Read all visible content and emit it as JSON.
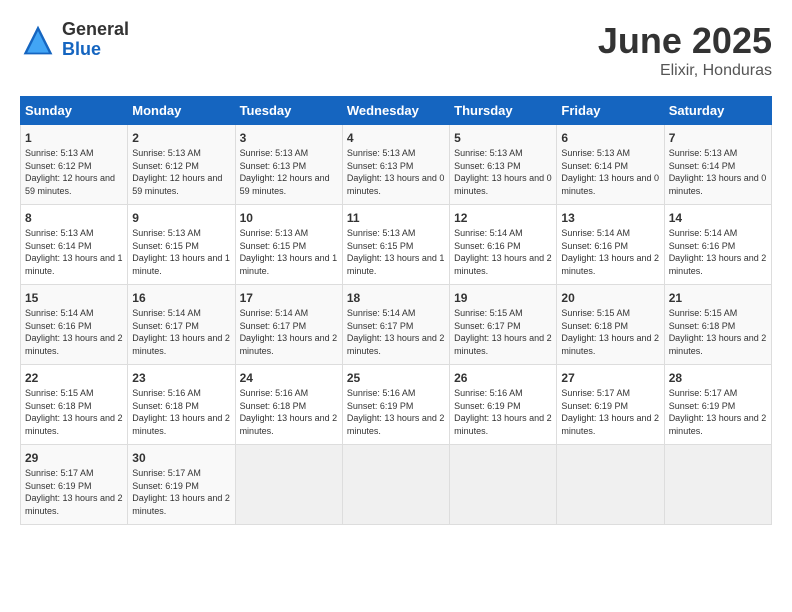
{
  "header": {
    "logo_general": "General",
    "logo_blue": "Blue",
    "title": "June 2025",
    "subtitle": "Elixir, Honduras"
  },
  "days_of_week": [
    "Sunday",
    "Monday",
    "Tuesday",
    "Wednesday",
    "Thursday",
    "Friday",
    "Saturday"
  ],
  "weeks": [
    [
      {
        "day": "1",
        "sunrise": "5:13 AM",
        "sunset": "6:12 PM",
        "daylight": "12 hours and 59 minutes."
      },
      {
        "day": "2",
        "sunrise": "5:13 AM",
        "sunset": "6:12 PM",
        "daylight": "12 hours and 59 minutes."
      },
      {
        "day": "3",
        "sunrise": "5:13 AM",
        "sunset": "6:13 PM",
        "daylight": "12 hours and 59 minutes."
      },
      {
        "day": "4",
        "sunrise": "5:13 AM",
        "sunset": "6:13 PM",
        "daylight": "13 hours and 0 minutes."
      },
      {
        "day": "5",
        "sunrise": "5:13 AM",
        "sunset": "6:13 PM",
        "daylight": "13 hours and 0 minutes."
      },
      {
        "day": "6",
        "sunrise": "5:13 AM",
        "sunset": "6:14 PM",
        "daylight": "13 hours and 0 minutes."
      },
      {
        "day": "7",
        "sunrise": "5:13 AM",
        "sunset": "6:14 PM",
        "daylight": "13 hours and 0 minutes."
      }
    ],
    [
      {
        "day": "8",
        "sunrise": "5:13 AM",
        "sunset": "6:14 PM",
        "daylight": "13 hours and 1 minute."
      },
      {
        "day": "9",
        "sunrise": "5:13 AM",
        "sunset": "6:15 PM",
        "daylight": "13 hours and 1 minute."
      },
      {
        "day": "10",
        "sunrise": "5:13 AM",
        "sunset": "6:15 PM",
        "daylight": "13 hours and 1 minute."
      },
      {
        "day": "11",
        "sunrise": "5:13 AM",
        "sunset": "6:15 PM",
        "daylight": "13 hours and 1 minute."
      },
      {
        "day": "12",
        "sunrise": "5:14 AM",
        "sunset": "6:16 PM",
        "daylight": "13 hours and 2 minutes."
      },
      {
        "day": "13",
        "sunrise": "5:14 AM",
        "sunset": "6:16 PM",
        "daylight": "13 hours and 2 minutes."
      },
      {
        "day": "14",
        "sunrise": "5:14 AM",
        "sunset": "6:16 PM",
        "daylight": "13 hours and 2 minutes."
      }
    ],
    [
      {
        "day": "15",
        "sunrise": "5:14 AM",
        "sunset": "6:16 PM",
        "daylight": "13 hours and 2 minutes."
      },
      {
        "day": "16",
        "sunrise": "5:14 AM",
        "sunset": "6:17 PM",
        "daylight": "13 hours and 2 minutes."
      },
      {
        "day": "17",
        "sunrise": "5:14 AM",
        "sunset": "6:17 PM",
        "daylight": "13 hours and 2 minutes."
      },
      {
        "day": "18",
        "sunrise": "5:14 AM",
        "sunset": "6:17 PM",
        "daylight": "13 hours and 2 minutes."
      },
      {
        "day": "19",
        "sunrise": "5:15 AM",
        "sunset": "6:17 PM",
        "daylight": "13 hours and 2 minutes."
      },
      {
        "day": "20",
        "sunrise": "5:15 AM",
        "sunset": "6:18 PM",
        "daylight": "13 hours and 2 minutes."
      },
      {
        "day": "21",
        "sunrise": "5:15 AM",
        "sunset": "6:18 PM",
        "daylight": "13 hours and 2 minutes."
      }
    ],
    [
      {
        "day": "22",
        "sunrise": "5:15 AM",
        "sunset": "6:18 PM",
        "daylight": "13 hours and 2 minutes."
      },
      {
        "day": "23",
        "sunrise": "5:16 AM",
        "sunset": "6:18 PM",
        "daylight": "13 hours and 2 minutes."
      },
      {
        "day": "24",
        "sunrise": "5:16 AM",
        "sunset": "6:18 PM",
        "daylight": "13 hours and 2 minutes."
      },
      {
        "day": "25",
        "sunrise": "5:16 AM",
        "sunset": "6:19 PM",
        "daylight": "13 hours and 2 minutes."
      },
      {
        "day": "26",
        "sunrise": "5:16 AM",
        "sunset": "6:19 PM",
        "daylight": "13 hours and 2 minutes."
      },
      {
        "day": "27",
        "sunrise": "5:17 AM",
        "sunset": "6:19 PM",
        "daylight": "13 hours and 2 minutes."
      },
      {
        "day": "28",
        "sunrise": "5:17 AM",
        "sunset": "6:19 PM",
        "daylight": "13 hours and 2 minutes."
      }
    ],
    [
      {
        "day": "29",
        "sunrise": "5:17 AM",
        "sunset": "6:19 PM",
        "daylight": "13 hours and 2 minutes."
      },
      {
        "day": "30",
        "sunrise": "5:17 AM",
        "sunset": "6:19 PM",
        "daylight": "13 hours and 2 minutes."
      },
      null,
      null,
      null,
      null,
      null
    ]
  ]
}
